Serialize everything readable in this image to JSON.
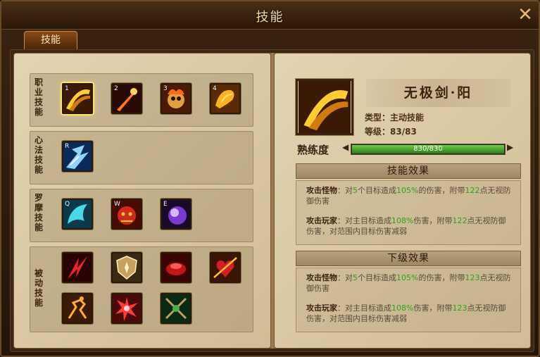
{
  "window": {
    "title": "技能",
    "close_glyph": "✕"
  },
  "tabs": [
    {
      "label": "技能"
    }
  ],
  "skill_groups": [
    {
      "label": "职业技能",
      "skills": [
        {
          "hotkey": "1",
          "icon": "golden-slash-icon",
          "selected": true
        },
        {
          "hotkey": "2",
          "icon": "fire-arrow-icon"
        },
        {
          "hotkey": "3",
          "icon": "flame-skull-icon"
        },
        {
          "hotkey": "4",
          "icon": "golden-dragon-icon"
        }
      ]
    },
    {
      "label": "心法技能",
      "skills": [
        {
          "hotkey": "R",
          "icon": "ice-burst-icon"
        }
      ]
    },
    {
      "label": "罗摩技能",
      "skills": [
        {
          "hotkey": "Q",
          "icon": "cyan-wing-icon"
        },
        {
          "hotkey": "W",
          "icon": "red-demon-icon"
        },
        {
          "hotkey": "E",
          "icon": "purple-orb-icon"
        }
      ]
    },
    {
      "label": "被动技能",
      "skills": [
        {
          "icon": "red-blades-icon"
        },
        {
          "icon": "shield-emblem-icon"
        },
        {
          "icon": "blood-vortex-icon"
        },
        {
          "icon": "pierced-heart-icon"
        },
        {
          "icon": "running-strike-icon"
        },
        {
          "icon": "red-burst-icon"
        },
        {
          "icon": "green-crossed-swords-icon"
        }
      ]
    }
  ],
  "detail": {
    "name": "无极剑·阳",
    "type_label": "类型：",
    "type_value": "主动技能",
    "level_label": "等级：",
    "level_value": "83/83",
    "proficiency_label": "熟练度",
    "proficiency_text": "830/830",
    "proficiency_fraction": 1.0,
    "effect_title": "技能效果",
    "next_title": "下级效果",
    "effect": {
      "monster_key": "攻击怪物",
      "monster_t1": "：对",
      "monster_n1": "5",
      "monster_t2": "个目标造成",
      "monster_n2": "105%",
      "monster_t3": "的伤害，附带",
      "monster_n3": "122",
      "monster_t4": "点无视防御伤害",
      "player_key": "攻击玩家",
      "player_t1": "：对主目标造成",
      "player_n1": "108%",
      "player_t2": "伤害，附带",
      "player_n2": "122",
      "player_t3": "点无视防御伤害，对范围内目标伤害减弱"
    },
    "next": {
      "monster_key": "攻击怪物",
      "monster_t1": "：对",
      "monster_n1": "5",
      "monster_t2": "个目标造成",
      "monster_n2": "105%",
      "monster_t3": "的伤害，附带",
      "monster_n3": "123",
      "monster_t4": "点无视防御伤害",
      "player_key": "攻击玩家",
      "player_t1": "：对主目标造成",
      "player_n1": "108%",
      "player_t2": "伤害，附带",
      "player_n2": "123",
      "player_t3": "点无视防御伤害，对范围内目标伤害减弱"
    }
  },
  "colors": {
    "highlight_number": "#2fa01a",
    "title_text": "#f4dcaa",
    "selected_glow": "#ffe070"
  }
}
